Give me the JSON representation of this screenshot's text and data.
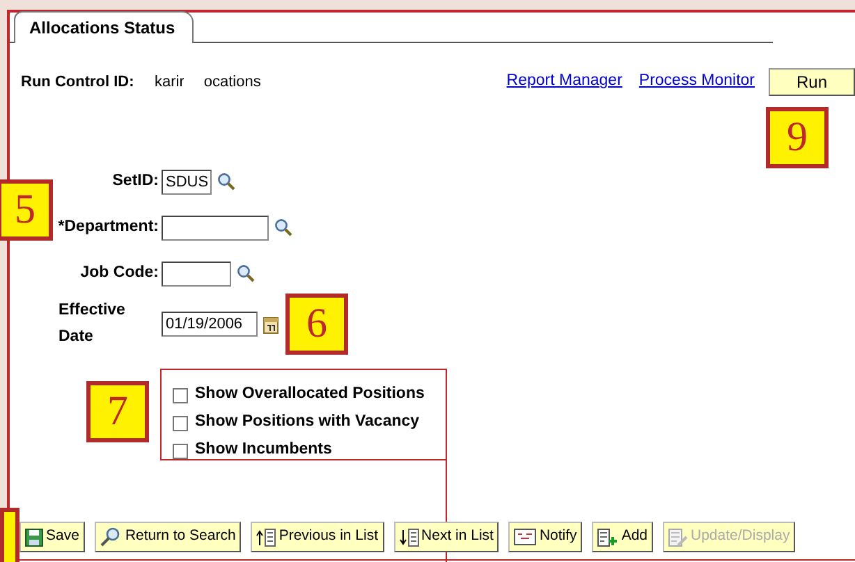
{
  "tab": {
    "label": "Allocations Status",
    "selected": true
  },
  "run_control": {
    "label": "Run Control ID:",
    "value_parts": [
      "karir",
      "ocations"
    ]
  },
  "links": [
    "Report Manager",
    "Process Monitor"
  ],
  "run_button": {
    "label": "Run",
    "callout": "9"
  },
  "fields": [
    {
      "kind": "lookup",
      "label": "SetID:",
      "value": "SDUS"
    },
    {
      "kind": "lookup",
      "label": "*Department:",
      "callout": "5"
    },
    {
      "kind": "lookup",
      "label": "Job Code:"
    },
    {
      "kind": "date",
      "label": "Effective Date",
      "value": "01/19/2006",
      "callout": "6"
    }
  ],
  "options": {
    "callout": "7",
    "items": [
      {
        "label": "Show Overallocated Positions",
        "checked": false
      },
      {
        "label": "Show Positions with Vacancy",
        "checked": false
      },
      {
        "label": "Show Incumbents",
        "checked": false
      }
    ]
  },
  "toolbar": [
    {
      "kind": "save",
      "label": "Save",
      "disabled": false
    },
    {
      "kind": "search",
      "label": "Return to Search",
      "disabled": false
    },
    {
      "kind": "previous",
      "label": "Previous in List",
      "disabled": false
    },
    {
      "kind": "next",
      "label": "Next in List",
      "disabled": false
    },
    {
      "kind": "notify",
      "label": "Notify",
      "disabled": false
    },
    {
      "kind": "add",
      "label": "Add",
      "disabled": false
    },
    {
      "kind": "update",
      "label": "Update/Display",
      "disabled": true
    }
  ]
}
